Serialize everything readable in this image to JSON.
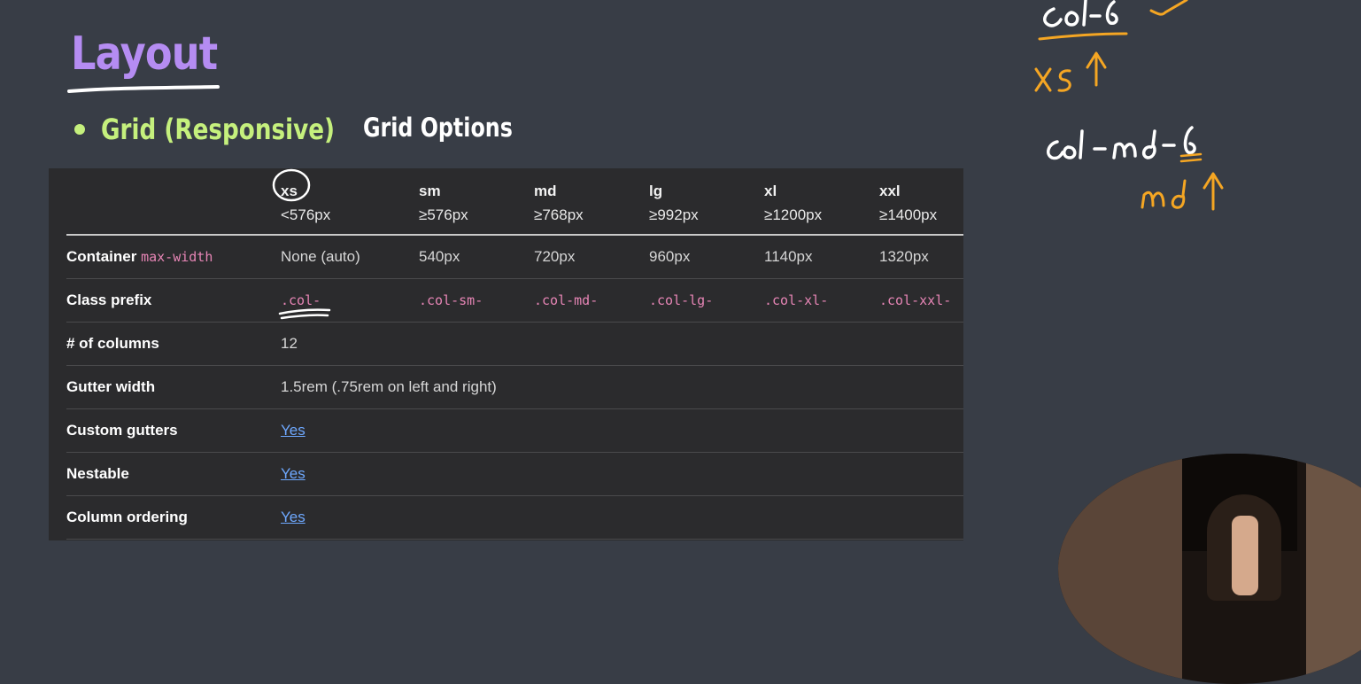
{
  "slide": {
    "title": "Layout",
    "bullet": "Grid (Responsive)",
    "subheading": "Grid Options"
  },
  "table": {
    "breakpoints": [
      {
        "name": "xs",
        "width": "<576px"
      },
      {
        "name": "sm",
        "width": "≥576px"
      },
      {
        "name": "md",
        "width": "≥768px"
      },
      {
        "name": "lg",
        "width": "≥992px"
      },
      {
        "name": "xl",
        "width": "≥1200px"
      },
      {
        "name": "xxl",
        "width": "≥1400px"
      }
    ],
    "container_row": {
      "label": "Container",
      "code": "max-width",
      "values": [
        "None (auto)",
        "540px",
        "720px",
        "960px",
        "1140px",
        "1320px"
      ]
    },
    "class_prefix_row": {
      "label": "Class prefix",
      "values": [
        ".col-",
        ".col-sm-",
        ".col-md-",
        ".col-lg-",
        ".col-xl-",
        ".col-xxl-"
      ]
    },
    "columns_row": {
      "label": "# of columns",
      "value": "12"
    },
    "gutter_row": {
      "label": "Gutter width",
      "value": "1.5rem (.75rem on left and right)"
    },
    "custom_gutters_row": {
      "label": "Custom gutters",
      "value": "Yes"
    },
    "nestable_row": {
      "label": "Nestable",
      "value": "Yes"
    },
    "ordering_row": {
      "label": "Column ordering",
      "value": "Yes"
    }
  },
  "annotations": {
    "note1": "col-6",
    "note2": "xs",
    "note3": "col-md-6",
    "note4": "md"
  },
  "colors": {
    "background": "#383d46",
    "title": "#b58cf2",
    "bullet": "#c5f07d",
    "table_bg": "#2b2b2d",
    "code": "#e685b5",
    "link": "#6ea8fe",
    "ink_orange": "#f5a623"
  }
}
